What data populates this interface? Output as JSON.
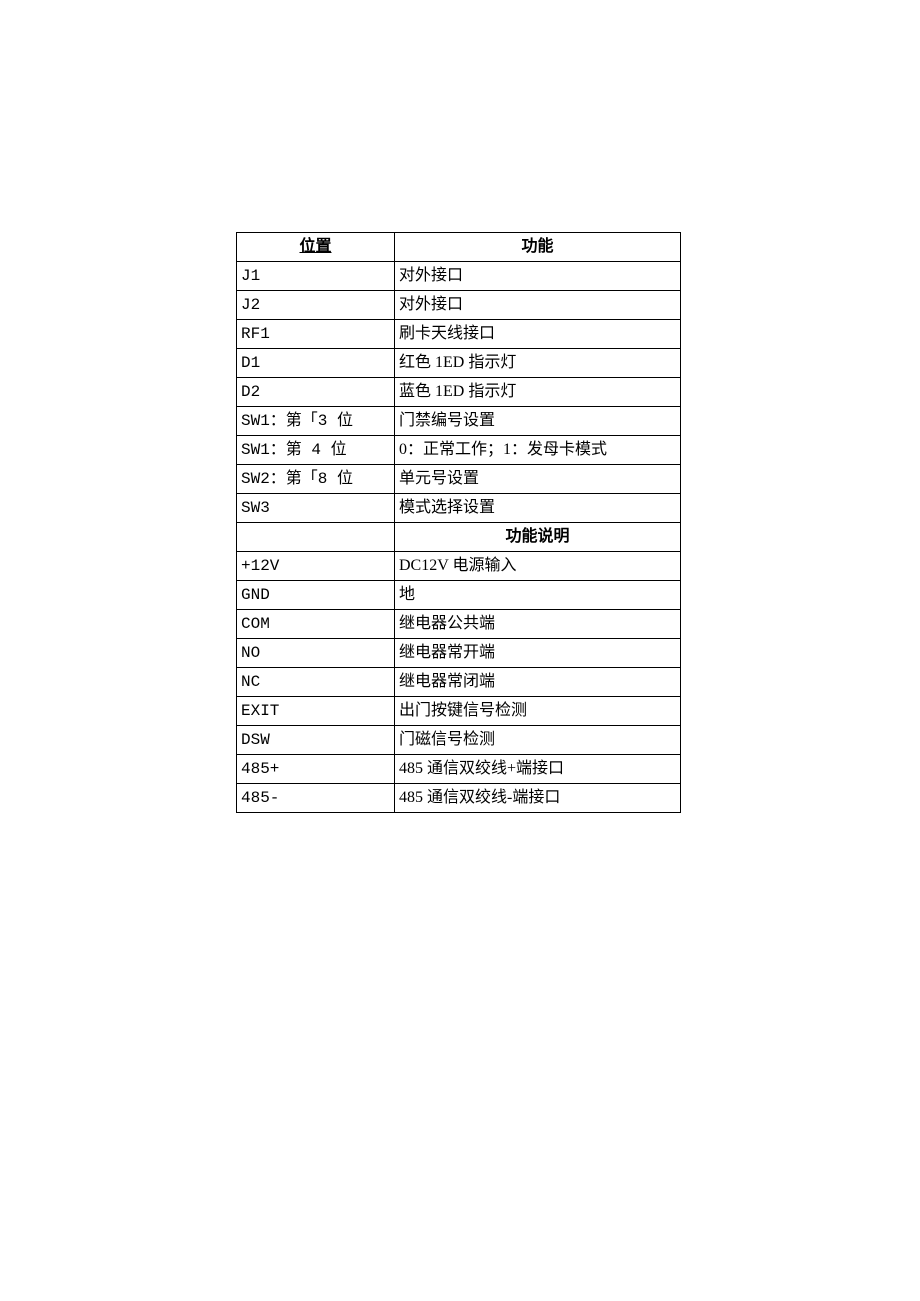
{
  "table": {
    "header1": {
      "col1": "位置",
      "col2": "功能"
    },
    "section1": [
      {
        "col1": "J1",
        "col2": "对外接口"
      },
      {
        "col1": "J2",
        "col2": "对外接口"
      },
      {
        "col1": "RF1",
        "col2": "刷卡天线接口"
      },
      {
        "col1": "D1",
        "col2": "红色 1ED 指示灯"
      },
      {
        "col1": "D2",
        "col2": "蓝色 1ED 指示灯"
      },
      {
        "col1": "SW1：第「3 位",
        "col2": "门禁编号设置"
      },
      {
        "col1": "SW1：第 4 位",
        "col2": "0：正常工作；1：发母卡模式"
      },
      {
        "col1": "SW2：第「8 位",
        "col2": "单元号设置"
      },
      {
        "col1": "SW3",
        "col2": "模式选择设置"
      }
    ],
    "header2": {
      "col1": "",
      "col2": "功能说明"
    },
    "section2": [
      {
        "col1": "+12V",
        "col2": "DC12V 电源输入"
      },
      {
        "col1": "GND",
        "col2": "地"
      },
      {
        "col1": "COM",
        "col2": "继电器公共端"
      },
      {
        "col1": "NO",
        "col2": "继电器常开端"
      },
      {
        "col1": "NC",
        "col2": "继电器常闭端"
      },
      {
        "col1": "EXIT",
        "col2": "出门按键信号检测"
      },
      {
        "col1": "DSW",
        "col2": "门磁信号检测"
      },
      {
        "col1": "485+",
        "col2": "485 通信双绞线+端接口"
      },
      {
        "col1": "485-",
        "col2": "485 通信双绞线-端接口"
      }
    ]
  }
}
